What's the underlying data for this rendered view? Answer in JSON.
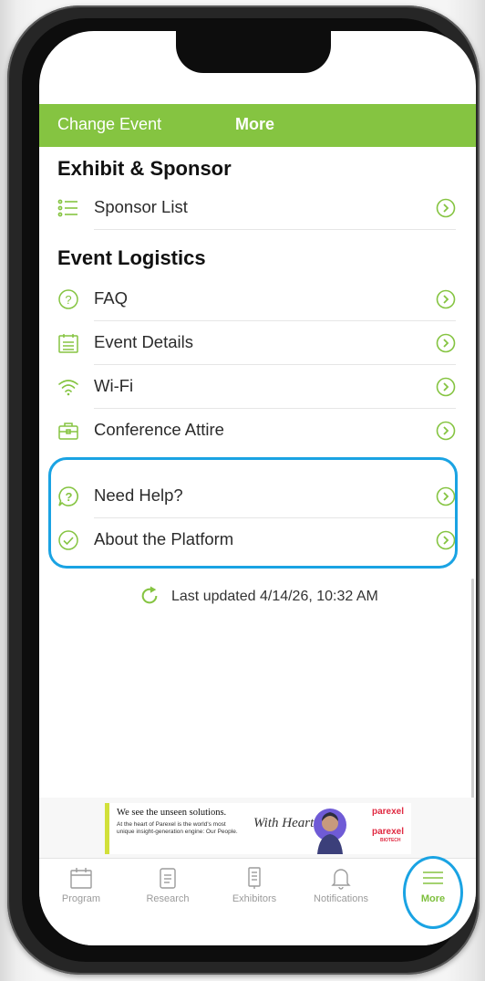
{
  "header": {
    "change_event": "Change Event",
    "title": "More"
  },
  "sections": [
    {
      "title": "Exhibit & Sponsor",
      "items": [
        {
          "label": "Sponsor List",
          "icon": "list-icon"
        }
      ]
    },
    {
      "title": "Event Logistics",
      "items": [
        {
          "label": "FAQ",
          "icon": "question-circle-icon"
        },
        {
          "label": "Event Details",
          "icon": "calendar-list-icon"
        },
        {
          "label": "Wi-Fi",
          "icon": "wifi-icon"
        },
        {
          "label": "Conference Attire",
          "icon": "briefcase-icon"
        },
        {
          "label": "Need Help?",
          "icon": "help-bubble-icon"
        },
        {
          "label": "About the Platform",
          "icon": "check-circle-icon"
        }
      ]
    }
  ],
  "last_updated": "Last updated 4/14/26, 10:32 AM",
  "ad": {
    "headline": "We see the unseen solutions.",
    "body": "At the heart of Parexel is the world's most unique insight-generation engine: Our People.",
    "signature": "With Heart",
    "brand": "parexel",
    "brand2": "parexel",
    "brand2_sub": "BIOTECH"
  },
  "tabs": [
    {
      "label": "Program",
      "icon": "calendar-icon"
    },
    {
      "label": "Research",
      "icon": "document-icon"
    },
    {
      "label": "Exhibitors",
      "icon": "booth-icon"
    },
    {
      "label": "Notifications",
      "icon": "bell-icon"
    },
    {
      "label": "More",
      "icon": "menu-icon",
      "active": true
    }
  ],
  "colors": {
    "accent": "#85c441",
    "highlight": "#1aa3e3",
    "active_tab": "#7dbf3c"
  }
}
